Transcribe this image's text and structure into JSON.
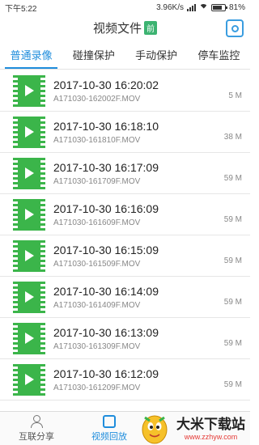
{
  "status_bar": {
    "time": "下午5:22",
    "speed": "3.96K/s",
    "battery": "81%",
    "battery_level": 0.81
  },
  "header": {
    "title": "视频文件",
    "badge": "前",
    "camera_icon": "camera-icon"
  },
  "tabs": [
    {
      "label": "普通录像",
      "active": true
    },
    {
      "label": "碰撞保护",
      "active": false
    },
    {
      "label": "手动保护",
      "active": false
    },
    {
      "label": "停车监控",
      "active": false
    }
  ],
  "videos": [
    {
      "date": "2017-10-30 16:20:02",
      "file": "A171030-162002F.MOV",
      "size": "5 M"
    },
    {
      "date": "2017-10-30 16:18:10",
      "file": "A171030-161810F.MOV",
      "size": "38 M"
    },
    {
      "date": "2017-10-30 16:17:09",
      "file": "A171030-161709F.MOV",
      "size": "59 M"
    },
    {
      "date": "2017-10-30 16:16:09",
      "file": "A171030-161609F.MOV",
      "size": "59 M"
    },
    {
      "date": "2017-10-30 16:15:09",
      "file": "A171030-161509F.MOV",
      "size": "59 M"
    },
    {
      "date": "2017-10-30 16:14:09",
      "file": "A171030-161409F.MOV",
      "size": "59 M"
    },
    {
      "date": "2017-10-30 16:13:09",
      "file": "A171030-161309F.MOV",
      "size": "59 M"
    },
    {
      "date": "2017-10-30 16:12:09",
      "file": "A171030-161209F.MOV",
      "size": "59 M"
    }
  ],
  "bottom_nav": [
    {
      "label": "互联分享",
      "icon": "user-icon",
      "active": false
    },
    {
      "label": "视频回放",
      "icon": "film-icon",
      "active": true
    }
  ],
  "watermark": {
    "name": "大米下载站",
    "url": "www.zzhyw.com"
  },
  "colors": {
    "accent": "#1f8ddc",
    "thumb_green": "#3bb54a",
    "badge_green": "#3cb371"
  }
}
